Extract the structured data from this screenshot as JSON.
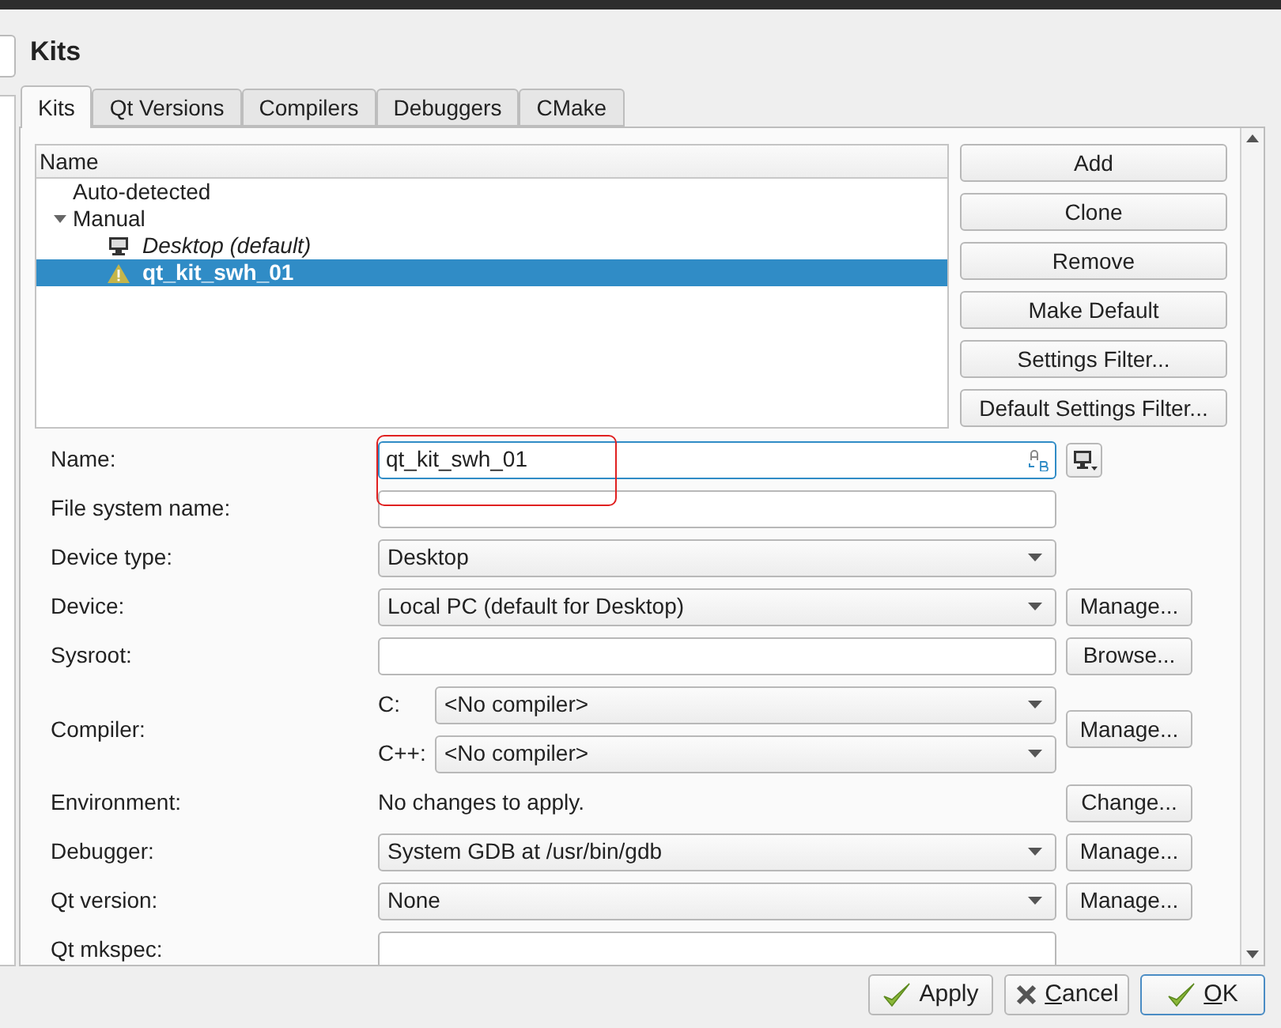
{
  "heading": "Kits",
  "tabs": [
    {
      "label": "Kits",
      "selected": true
    },
    {
      "label": "Qt Versions",
      "selected": false
    },
    {
      "label": "Compilers",
      "selected": false
    },
    {
      "label": "Debuggers",
      "selected": false
    },
    {
      "label": "CMake",
      "selected": false
    }
  ],
  "kit_tree": {
    "column": "Name",
    "items": [
      {
        "label": "Auto-detected",
        "selected": false
      },
      {
        "label": "Manual",
        "expanded": true,
        "selected": false,
        "children": [
          {
            "label": "Desktop (default)",
            "kind": "desktop",
            "default": true,
            "selected": false
          },
          {
            "label": "qt_kit_swh_01",
            "kind": "warning",
            "default": false,
            "selected": true
          }
        ]
      }
    ]
  },
  "kit_buttons": [
    "Add",
    "Clone",
    "Remove",
    "Make Default",
    "Settings Filter...",
    "Default Settings Filter..."
  ],
  "form": [
    {
      "kind": "name",
      "label": "Name:",
      "value": "qt_kit_swh_01"
    },
    {
      "kind": "text",
      "label": "File system name:"
    },
    {
      "kind": "combo",
      "label": "Device type:",
      "value": "Desktop"
    },
    {
      "kind": "combo",
      "label": "Device:",
      "value": "Local PC (default for Desktop)",
      "button": "Manage..."
    },
    {
      "kind": "text",
      "label": "Sysroot:",
      "button": "Browse..."
    },
    {
      "kind": "compiler",
      "label": "Compiler:",
      "subrows": [
        {
          "label": "C:",
          "value": "<No compiler>"
        },
        {
          "label": "C++:",
          "value": "<No compiler>"
        }
      ],
      "button": "Manage..."
    },
    {
      "kind": "info",
      "label": "Environment:",
      "value": "No changes to apply.",
      "button": "Change..."
    },
    {
      "kind": "combo",
      "label": "Debugger:",
      "value": "System GDB at /usr/bin/gdb",
      "button": "Manage..."
    },
    {
      "kind": "combo",
      "label": "Qt version:",
      "value": "None",
      "button": "Manage..."
    },
    {
      "kind": "text",
      "label": "Qt mkspec:"
    }
  ],
  "dialog_buttons": [
    {
      "label": "Apply",
      "kind": "accept",
      "underline_first": false,
      "default": false
    },
    {
      "label": "Cancel",
      "kind": "reject",
      "underline_first": true,
      "default": false
    },
    {
      "label": "OK",
      "kind": "accept",
      "underline_first": true,
      "default": true
    }
  ]
}
